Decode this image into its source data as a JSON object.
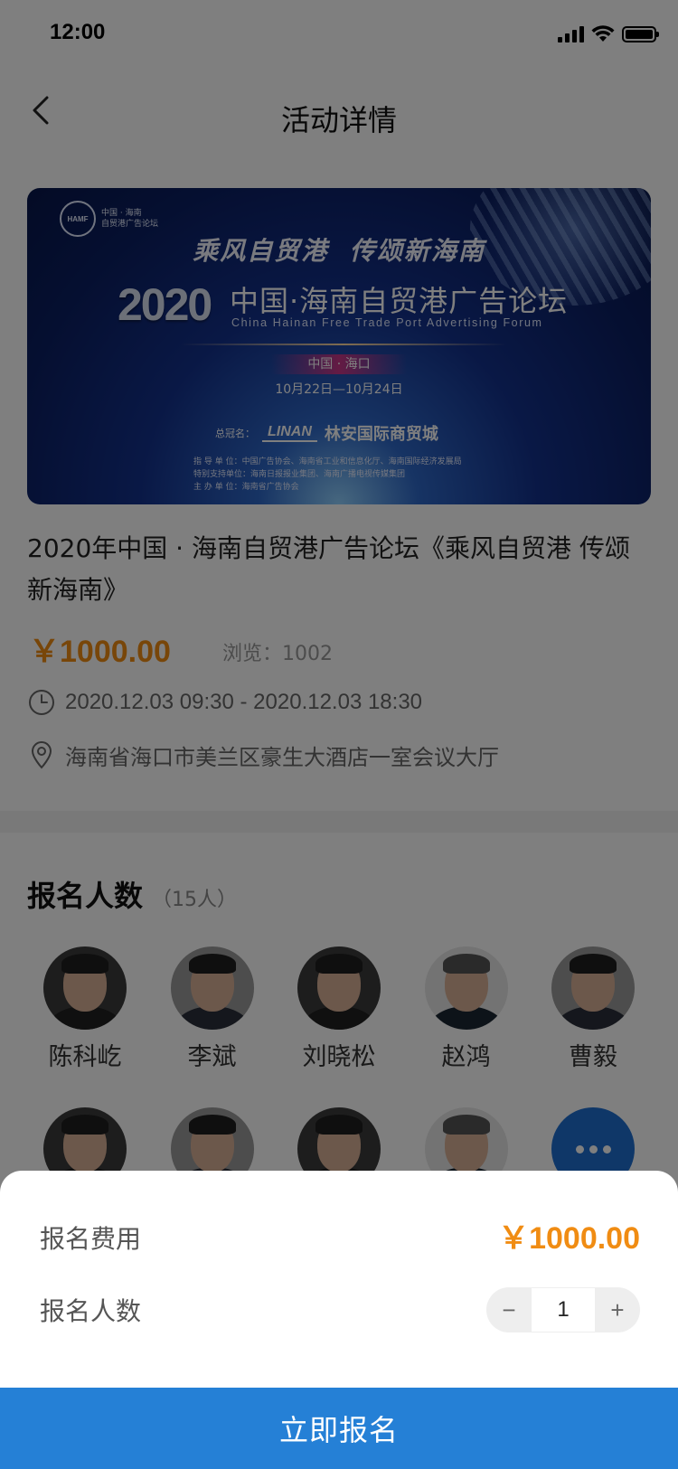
{
  "status_bar": {
    "time": "12:00"
  },
  "nav": {
    "title": "活动详情"
  },
  "banner": {
    "logo_abbr": "HAMF",
    "logo_text": "中国 · 海南\n自贸港广告论坛",
    "slogan": "乘风自贸港  传颂新海南",
    "year": "2020",
    "main_title": "中国·海南自贸港广告论坛",
    "english_title": "China Hainan Free Trade Port Advertising Forum",
    "place": "中国 · 海口",
    "dates": "10月22日—10月24日",
    "sponsor_label": "总冠名：",
    "sponsor_logo": "LINAN",
    "sponsor_name": "林安国际商贸城",
    "credits": [
      "指  导  单  位：中国广告协会、海南省工业和信息化厅、海南国际经济发展局",
      "特别支持单位：海南日报报业集团、海南广播电视传媒集团",
      "主  办  单  位：海南省广告协会"
    ]
  },
  "event": {
    "title": "2020年中国 · 海南自贸港广告论坛《乘风自贸港 传颂新海南》",
    "price": "￥1000.00",
    "views": "浏览：1002",
    "time": "2020.12.03 09:30 - 2020.12.03 18:30",
    "address": "海南省海口市美兰区豪生大酒店一室会议大厅"
  },
  "signup": {
    "title": "报名人数",
    "count": "（15人）",
    "people_row1": [
      {
        "name": "陈科屹"
      },
      {
        "name": "李斌"
      },
      {
        "name": "刘晓松"
      },
      {
        "name": "赵鸿"
      },
      {
        "name": "曹毅"
      }
    ]
  },
  "sheet": {
    "fee_label": "报名费用",
    "fee_value": "￥1000.00",
    "count_label": "报名人数",
    "minus": "−",
    "quantity": "1",
    "plus": "+",
    "submit": "立即报名"
  },
  "colors": {
    "accent": "#f08c13",
    "primary": "#2580d6"
  }
}
